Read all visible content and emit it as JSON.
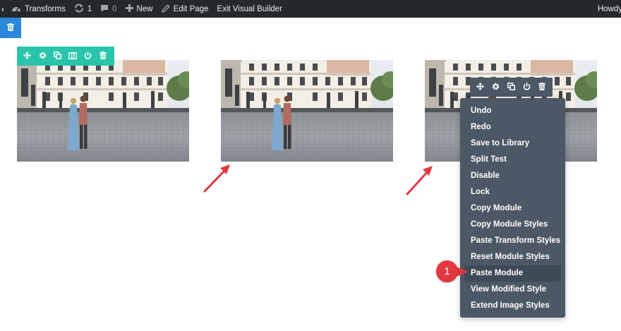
{
  "admin_bar": {
    "site_name": "Transforms",
    "updates_count": "1",
    "comments_count": "0",
    "new_label": "New",
    "edit_page_label": "Edit Page",
    "exit_builder_label": "Exit Visual Builder",
    "greeting": "Howdy"
  },
  "context_menu": {
    "items": [
      "Undo",
      "Redo",
      "Save to Library",
      "Split Test",
      "Disable",
      "Lock",
      "Copy Module",
      "Copy Module Styles",
      "Paste Transform Styles",
      "Reset Module Styles",
      "Paste Module",
      "View Modified Style",
      "Extend Image Styles"
    ],
    "highlighted_item": "Paste Module"
  },
  "step_marker": {
    "number": "1"
  },
  "colors": {
    "admin_bar_bg": "#23282d",
    "builder_blue": "#2b87da",
    "module_toolbar_green": "#29c4a9",
    "menu_bg": "#4c5866",
    "annotation_red": "#e2383f"
  },
  "icons": {
    "module_toolbar": [
      "move-icon",
      "gear-icon",
      "duplicate-icon",
      "columns-icon",
      "power-icon",
      "trash-icon"
    ],
    "menu_toolbar": [
      "move-icon",
      "gear-icon",
      "duplicate-icon",
      "power-icon",
      "trash-icon"
    ]
  }
}
